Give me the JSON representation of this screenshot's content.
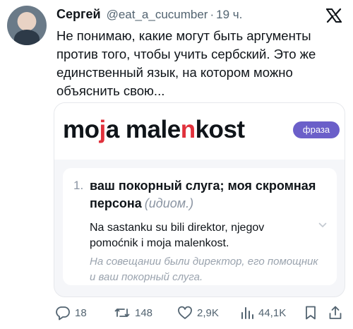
{
  "tweet": {
    "author_name": "Сергей",
    "handle": "@eat_a_cucumber",
    "separator": "·",
    "time": "19 ч.",
    "text": "Не понимаю, какие могут быть аргументы против того, чтобы учить сербский. Это же единственный язык, на котором можно объяснить свою..."
  },
  "card": {
    "phrase_prefix": "mo",
    "phrase_hl1": "j",
    "phrase_mid": "a male",
    "phrase_hl2": "n",
    "phrase_suffix": "kost",
    "badge": "фраза",
    "number": "1.",
    "meaning": "ваш покорный слуга; моя скромная персона",
    "meaning_tag": "(идиом.)",
    "example": "Na sastanku su bili direktor, njegov pomoćnik i moja malenkost.",
    "translation": "На совещании были директор, его помощник и ваш покорный слуга."
  },
  "actions": {
    "replies": "18",
    "reposts": "148",
    "likes": "2,9K",
    "views": "44,1K"
  },
  "icons": [
    "x-logo-icon",
    "reply-icon",
    "repost-icon",
    "like-icon",
    "views-icon",
    "bookmark-icon",
    "share-icon",
    "chevron-down-icon"
  ],
  "colors": {
    "highlight": "#e0313c",
    "badge": "#6b5fc9",
    "muted": "#536471"
  }
}
